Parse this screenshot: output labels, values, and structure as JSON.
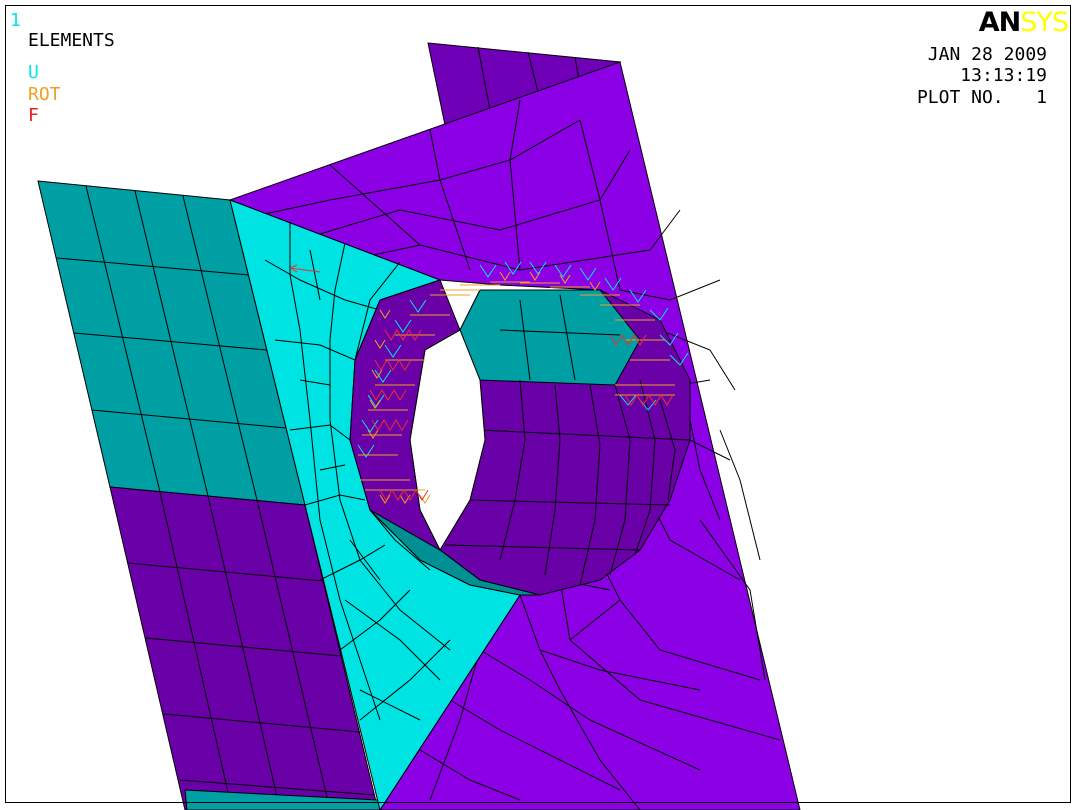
{
  "window": {
    "number": "1"
  },
  "legend": {
    "title": "ELEMENTS",
    "items": [
      {
        "label": "U",
        "color": "#00e8e8"
      },
      {
        "label": "ROT",
        "color": "#f0a020"
      },
      {
        "label": "F",
        "color": "#e82020"
      }
    ]
  },
  "logo": {
    "part1": "AN",
    "part2": "SYS"
  },
  "info": {
    "date": "JAN 28 2009",
    "time": "13:13:19",
    "plot": "PLOT NO.   1"
  },
  "colors": {
    "teal": "#009fa3",
    "cyan": "#00e3e3",
    "purple": "#8c00e6",
    "dark_purple": "#6a00a8",
    "bore": "#5a0090"
  }
}
